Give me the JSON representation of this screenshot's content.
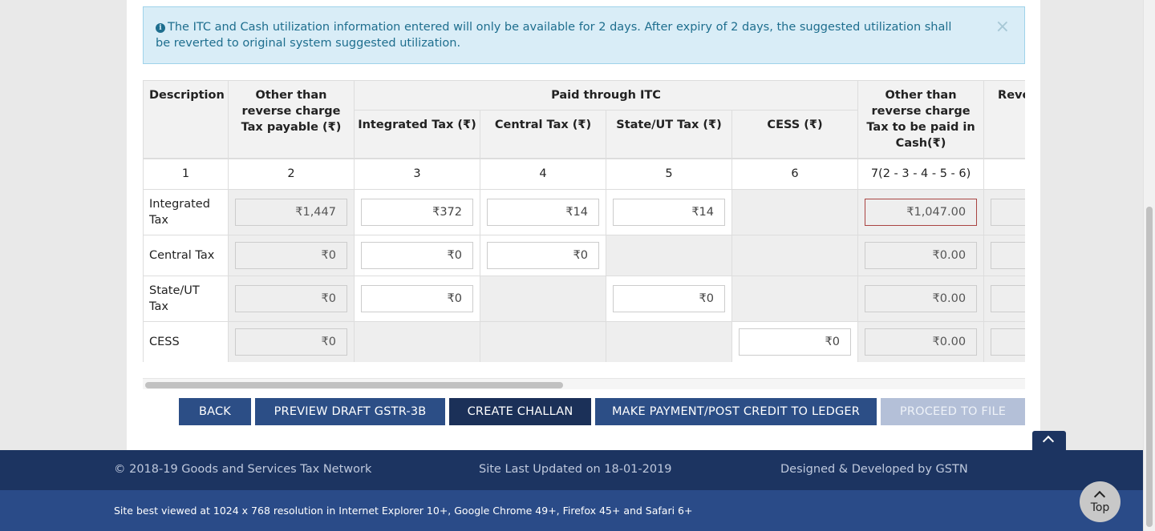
{
  "alert": {
    "message": "The ITC and Cash utilization information entered will only be available for 2 days. After expiry of 2 days, the suggested utilization shall be reverted to original system suggested utilization.",
    "close": "×",
    "icon": "info-circle-icon"
  },
  "table": {
    "headers": {
      "description": "Description",
      "tax_payable": "Other than reverse charge Tax payable (₹)",
      "paid_through_itc": "Paid through ITC",
      "integrated": "Integrated Tax (₹)",
      "central": "Central Tax (₹)",
      "state": "State/UT Tax (₹)",
      "cess": "CESS (₹)",
      "cash": "Other than reverse charge Tax to be paid in Cash(₹)",
      "reverse_partial": "Reve Tax"
    },
    "col_numbers": [
      "1",
      "2",
      "3",
      "4",
      "5",
      "6",
      "7(2 - 3 - 4 - 5 - 6)",
      ""
    ],
    "rows": [
      {
        "label": "Integrated Tax",
        "payable": "₹1,447",
        "igst": "₹372",
        "cgst": "₹14",
        "sgst": "₹14",
        "cash": "₹1,047.00"
      },
      {
        "label": "Central Tax",
        "payable": "₹0",
        "igst": "₹0",
        "cgst": "₹0",
        "cash": "₹0.00"
      },
      {
        "label": "State/UT Tax",
        "payable": "₹0",
        "igst": "₹0",
        "sgst": "₹0",
        "cash": "₹0.00"
      },
      {
        "label": "CESS",
        "payable": "₹0",
        "cess": "₹0",
        "cash": "₹0.00"
      }
    ]
  },
  "actions": {
    "back": "BACK",
    "preview": "PREVIEW DRAFT GSTR-3B",
    "challan": "CREATE CHALLAN",
    "payment": "MAKE PAYMENT/POST CREDIT TO LEDGER",
    "proceed": "PROCEED TO FILE"
  },
  "footer": {
    "copyright": "© 2018-19 Goods and Services Tax Network",
    "updated": "Site Last Updated on 18-01-2019",
    "designed": "Designed & Developed by GSTN",
    "best_viewed": "Site best viewed at 1024 x 768 resolution in Internet Explorer 10+, Google Chrome 49+, Firefox 45+ and Safari 6+",
    "top_label": "Top"
  },
  "colors": {
    "primary": "#2c4e86",
    "primary_dark": "#1b3058",
    "footer": "#1c3461",
    "alert_bg": "#d9edf7",
    "error_border": "#a94442"
  }
}
